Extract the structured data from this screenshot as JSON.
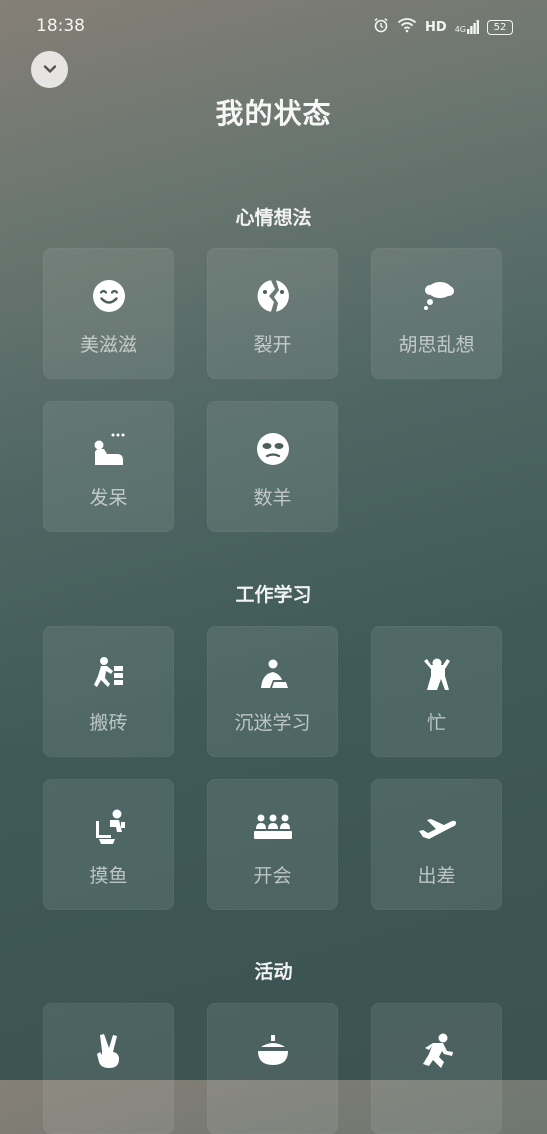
{
  "status_bar": {
    "time": "18:38",
    "hd": "HD",
    "network": "4G",
    "battery": "52"
  },
  "page": {
    "title": "我的状态"
  },
  "sections": [
    {
      "title": "心情想法",
      "items": [
        {
          "label": "美滋滋",
          "icon": "smile-icon"
        },
        {
          "label": "裂开",
          "icon": "cracked-face-icon"
        },
        {
          "label": "胡思乱想",
          "icon": "thought-bubble-icon"
        },
        {
          "label": "发呆",
          "icon": "daze-icon"
        },
        {
          "label": "数羊",
          "icon": "sheep-face-icon"
        }
      ]
    },
    {
      "title": "工作学习",
      "items": [
        {
          "label": "搬砖",
          "icon": "carry-bricks-icon"
        },
        {
          "label": "沉迷学习",
          "icon": "study-icon"
        },
        {
          "label": "忙",
          "icon": "busy-person-icon"
        },
        {
          "label": "摸鱼",
          "icon": "slacking-icon"
        },
        {
          "label": "开会",
          "icon": "meeting-icon"
        },
        {
          "label": "出差",
          "icon": "airplane-icon"
        }
      ]
    },
    {
      "title": "活动",
      "items": [
        {
          "label": "",
          "icon": "victory-hand-icon"
        },
        {
          "label": "",
          "icon": "food-bowl-icon"
        },
        {
          "label": "",
          "icon": "running-icon"
        }
      ]
    }
  ]
}
